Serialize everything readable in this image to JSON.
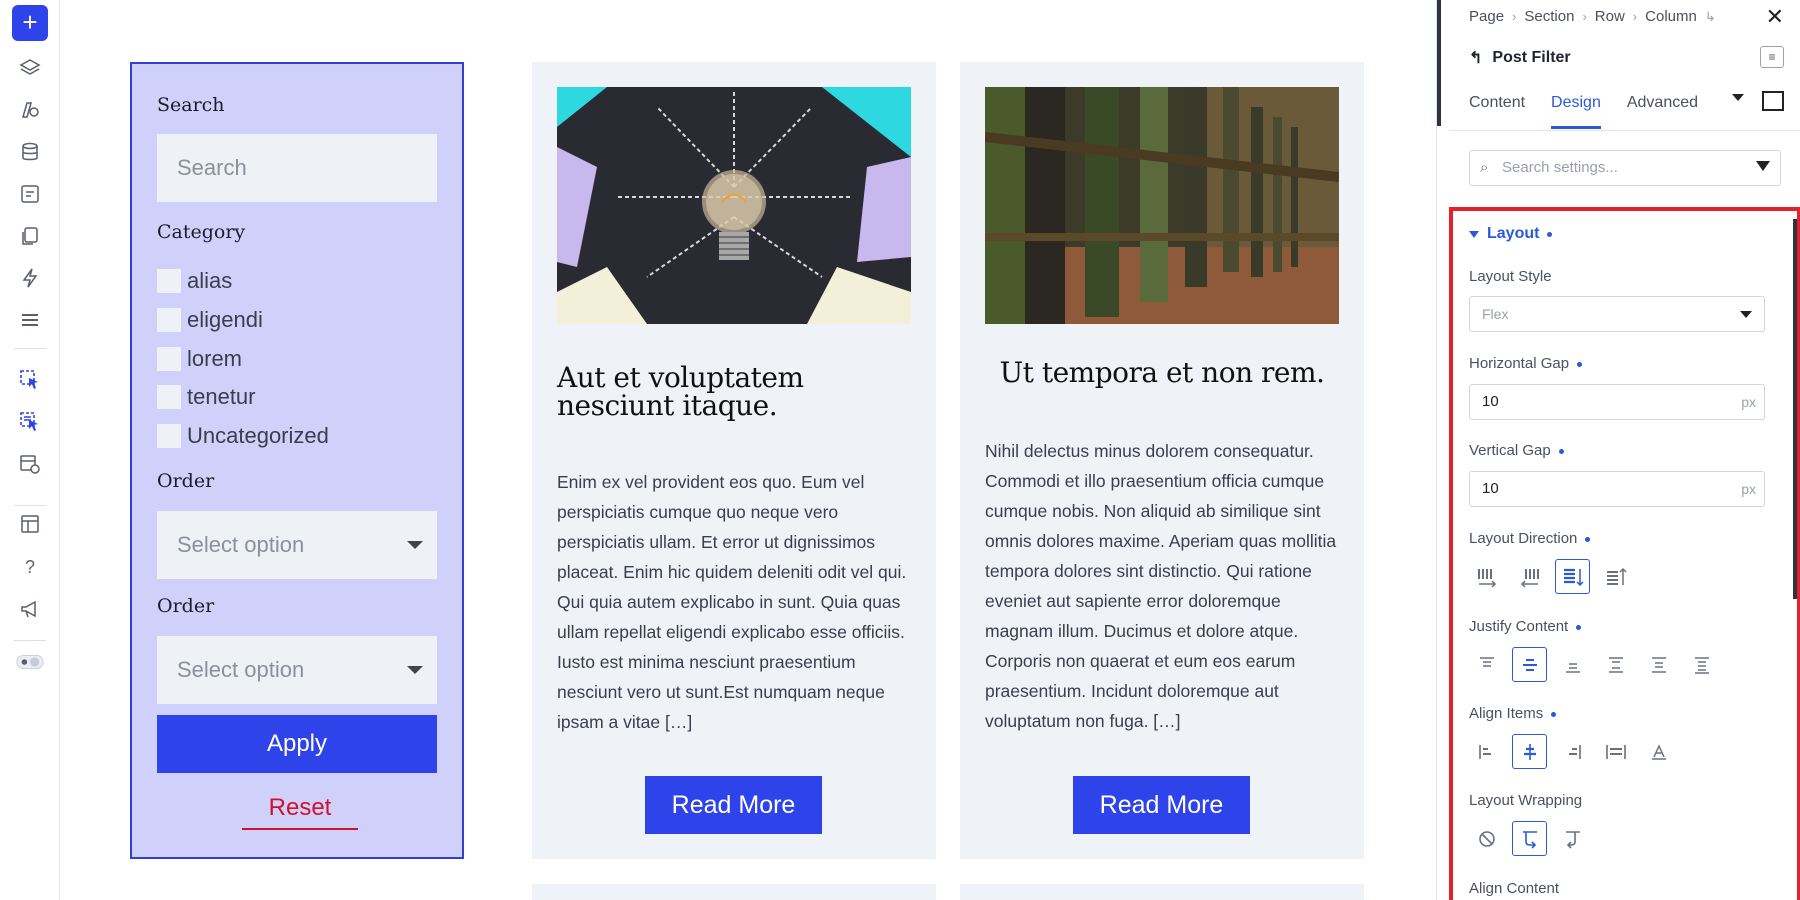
{
  "left_rail": {
    "icons": [
      "add-icon",
      "layers-icon",
      "styles-icon",
      "database-icon",
      "template-icon",
      "pages-icon",
      "bolt-icon",
      "list-icon",
      "click-select-icon",
      "multi-select-icon",
      "preview-icon",
      "windows-icon",
      "help-icon",
      "megaphone-icon",
      "toggle-icon"
    ],
    "add_label": "+"
  },
  "filter": {
    "search_label": "Search",
    "search_placeholder": "Search",
    "category_label": "Category",
    "categories": [
      "alias",
      "eligendi",
      "lorem",
      "tenetur",
      "Uncategorized"
    ],
    "order1_label": "Order",
    "order1_value": "Select option",
    "order2_label": "Order",
    "order2_value": "Select option",
    "apply_label": "Apply",
    "reset_label": "Reset"
  },
  "cards": [
    {
      "title": "Aut et voluptatem nesciunt itaque.",
      "body": "Enim ex vel provident eos quo. Eum vel perspiciatis cumque quo neque vero perspiciatis ullam. Et error ut dignissimos placeat. Enim hic quidem deleniti odit vel qui. Qui quia autem explicabo in sunt. Quia quas ullam repellat eligendi explicabo esse officiis. Iusto est minima nesciunt praesentium nesciunt vero ut sunt.Est numquam neque ipsam a vitae […]",
      "button": "Read More"
    },
    {
      "title": "Ut tempora et non rem.",
      "body": "Nihil delectus minus dolorem consequatur. Commodi et illo praesentium officia cumque cumque nobis. Non aliquid ab similique sint omnis dolores maxime. Aperiam quas mollitia tempora dolores sint distinctio. Qui ratione eveniet aut sapiente error doloremque magnam illum. Ducimus et dolore atque. Corporis non quaerat et eum eos earum praesentium. Incidunt doloremque aut voluptatum non fuga. […]",
      "button": "Read More"
    }
  ],
  "panel": {
    "breadcrumb": [
      "Page",
      "Section",
      "Row",
      "Column"
    ],
    "element_title": "Post Filter",
    "tabs": [
      "Content",
      "Design",
      "Advanced"
    ],
    "active_tab": "Design",
    "search_placeholder": "Search settings...",
    "section_title": "Layout",
    "layout_style_label": "Layout Style",
    "layout_style_value": "Flex",
    "horizontal_gap_label": "Horizontal Gap",
    "horizontal_gap_value": "10",
    "vertical_gap_label": "Vertical Gap",
    "vertical_gap_value": "10",
    "unit": "px",
    "layout_direction_label": "Layout Direction",
    "justify_content_label": "Justify Content",
    "align_items_label": "Align Items",
    "layout_wrapping_label": "Layout Wrapping",
    "align_content_label": "Align Content"
  },
  "colors": {
    "accent": "#2e44ea",
    "filter_bg": "#cfd1fb",
    "reset_red": "#d0112b",
    "highlight_red": "#e4202c",
    "panel_blue": "#2b5ad6"
  }
}
